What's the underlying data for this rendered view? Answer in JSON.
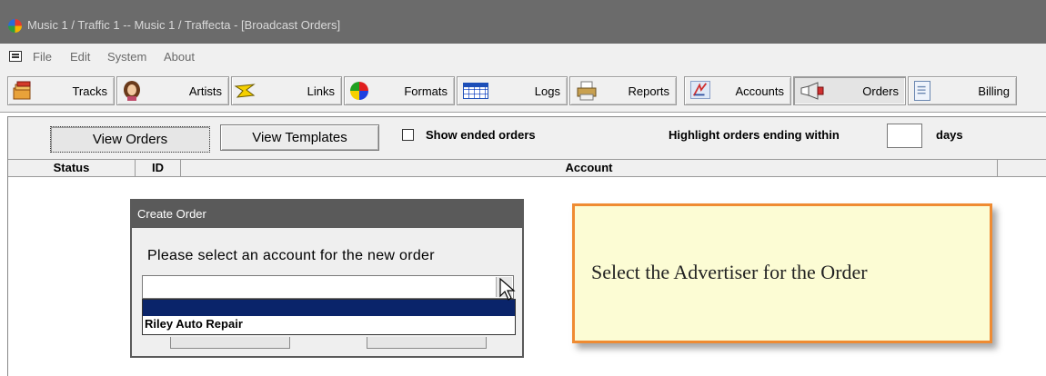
{
  "window": {
    "title": "Music 1 / Traffic 1 -- Music 1 / Traffecta - [Broadcast Orders]"
  },
  "menu": {
    "items": [
      "File",
      "Edit",
      "System",
      "About"
    ]
  },
  "toolbar": {
    "buttons": [
      {
        "label": "Tracks",
        "icon": "tracks-icon"
      },
      {
        "label": "Artists",
        "icon": "artists-icon"
      },
      {
        "label": "Links",
        "icon": "links-icon"
      },
      {
        "label": "Formats",
        "icon": "formats-icon"
      },
      {
        "label": "Logs",
        "icon": "logs-icon"
      },
      {
        "label": "Reports",
        "icon": "reports-icon"
      },
      {
        "label": "Accounts",
        "icon": "accounts-icon"
      },
      {
        "label": "Orders",
        "icon": "orders-icon",
        "active": true
      },
      {
        "label": "Billing",
        "icon": "billing-icon"
      }
    ]
  },
  "controls": {
    "view_orders": "View Orders",
    "view_templates": "View Templates",
    "show_ended_label": "Show ended orders",
    "show_ended_checked": false,
    "highlight_label": "Highlight orders ending within",
    "highlight_value": "",
    "days_label": "days"
  },
  "grid": {
    "columns": [
      "Status",
      "ID",
      "Account"
    ]
  },
  "dialog": {
    "title": "Create Order",
    "prompt": "Please select an account for the new order",
    "combo_value": "",
    "options": [
      "",
      "Riley Auto Repair"
    ]
  },
  "callout": {
    "text": "Select the Advertiser for the Order"
  },
  "colors": {
    "title_bar": "#6b6b6b",
    "dialog_title": "#5a5a5a",
    "selection": "#0a246a",
    "callout_bg": "#fcfcd4",
    "callout_border": "#ef8b32"
  }
}
